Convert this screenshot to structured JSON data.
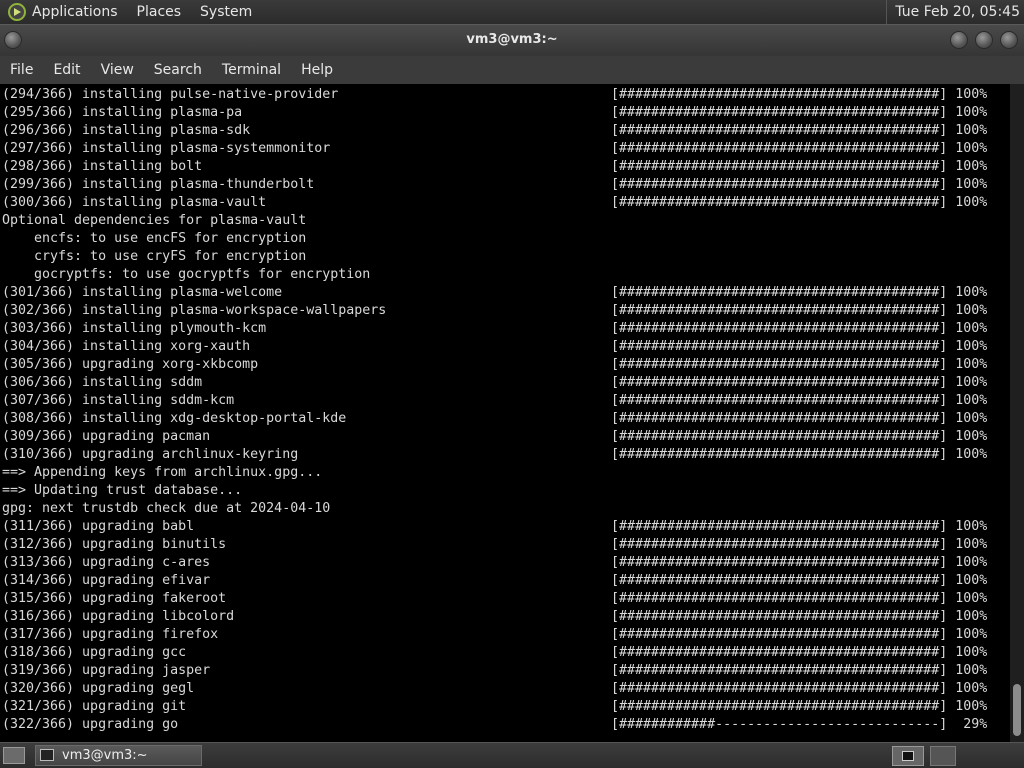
{
  "top_panel": {
    "menus": [
      "Applications",
      "Places",
      "System"
    ],
    "clock": "Tue Feb 20, 05:45"
  },
  "window": {
    "title": "vm3@vm3:~"
  },
  "menubar": [
    "File",
    "Edit",
    "View",
    "Search",
    "Terminal",
    "Help"
  ],
  "terminal_lines": [
    {
      "text": "(294/366) installing pulse-native-provider",
      "bar": "[########################################]",
      "pct": "100%"
    },
    {
      "text": "(295/366) installing plasma-pa",
      "bar": "[########################################]",
      "pct": "100%"
    },
    {
      "text": "(296/366) installing plasma-sdk",
      "bar": "[########################################]",
      "pct": "100%"
    },
    {
      "text": "(297/366) installing plasma-systemmonitor",
      "bar": "[########################################]",
      "pct": "100%"
    },
    {
      "text": "(298/366) installing bolt",
      "bar": "[########################################]",
      "pct": "100%"
    },
    {
      "text": "(299/366) installing plasma-thunderbolt",
      "bar": "[########################################]",
      "pct": "100%"
    },
    {
      "text": "(300/366) installing plasma-vault",
      "bar": "[########################################]",
      "pct": "100%"
    },
    {
      "text": "Optional dependencies for plasma-vault",
      "bar": "",
      "pct": ""
    },
    {
      "text": "    encfs: to use encFS for encryption",
      "bar": "",
      "pct": ""
    },
    {
      "text": "    cryfs: to use cryFS for encryption",
      "bar": "",
      "pct": ""
    },
    {
      "text": "    gocryptfs: to use gocryptfs for encryption",
      "bar": "",
      "pct": ""
    },
    {
      "text": "(301/366) installing plasma-welcome",
      "bar": "[########################################]",
      "pct": "100%"
    },
    {
      "text": "(302/366) installing plasma-workspace-wallpapers",
      "bar": "[########################################]",
      "pct": "100%"
    },
    {
      "text": "(303/366) installing plymouth-kcm",
      "bar": "[########################################]",
      "pct": "100%"
    },
    {
      "text": "(304/366) installing xorg-xauth",
      "bar": "[########################################]",
      "pct": "100%"
    },
    {
      "text": "(305/366) upgrading xorg-xkbcomp",
      "bar": "[########################################]",
      "pct": "100%"
    },
    {
      "text": "(306/366) installing sddm",
      "bar": "[########################################]",
      "pct": "100%"
    },
    {
      "text": "(307/366) installing sddm-kcm",
      "bar": "[########################################]",
      "pct": "100%"
    },
    {
      "text": "(308/366) installing xdg-desktop-portal-kde",
      "bar": "[########################################]",
      "pct": "100%"
    },
    {
      "text": "(309/366) upgrading pacman",
      "bar": "[########################################]",
      "pct": "100%"
    },
    {
      "text": "(310/366) upgrading archlinux-keyring",
      "bar": "[########################################]",
      "pct": "100%"
    },
    {
      "text": "==> Appending keys from archlinux.gpg...",
      "bar": "",
      "pct": ""
    },
    {
      "text": "==> Updating trust database...",
      "bar": "",
      "pct": ""
    },
    {
      "text": "gpg: next trustdb check due at 2024-04-10",
      "bar": "",
      "pct": ""
    },
    {
      "text": "(311/366) upgrading babl",
      "bar": "[########################################]",
      "pct": "100%"
    },
    {
      "text": "(312/366) upgrading binutils",
      "bar": "[########################################]",
      "pct": "100%"
    },
    {
      "text": "(313/366) upgrading c-ares",
      "bar": "[########################################]",
      "pct": "100%"
    },
    {
      "text": "(314/366) upgrading efivar",
      "bar": "[########################################]",
      "pct": "100%"
    },
    {
      "text": "(315/366) upgrading fakeroot",
      "bar": "[########################################]",
      "pct": "100%"
    },
    {
      "text": "(316/366) upgrading libcolord",
      "bar": "[########################################]",
      "pct": "100%"
    },
    {
      "text": "(317/366) upgrading firefox",
      "bar": "[########################################]",
      "pct": "100%"
    },
    {
      "text": "(318/366) upgrading gcc",
      "bar": "[########################################]",
      "pct": "100%"
    },
    {
      "text": "(319/366) upgrading jasper",
      "bar": "[########################################]",
      "pct": "100%"
    },
    {
      "text": "(320/366) upgrading gegl",
      "bar": "[########################################]",
      "pct": "100%"
    },
    {
      "text": "(321/366) upgrading git",
      "bar": "[########################################]",
      "pct": "100%"
    },
    {
      "text": "(322/366) upgrading go",
      "bar": "[############----------------------------]",
      "pct": " 29%"
    }
  ],
  "taskbar": {
    "task_label": "vm3@vm3:~"
  },
  "colors": {
    "terminal_bg": "#000000",
    "terminal_fg": "#d9d9d9",
    "panel_bg": "#2b2b2b"
  }
}
